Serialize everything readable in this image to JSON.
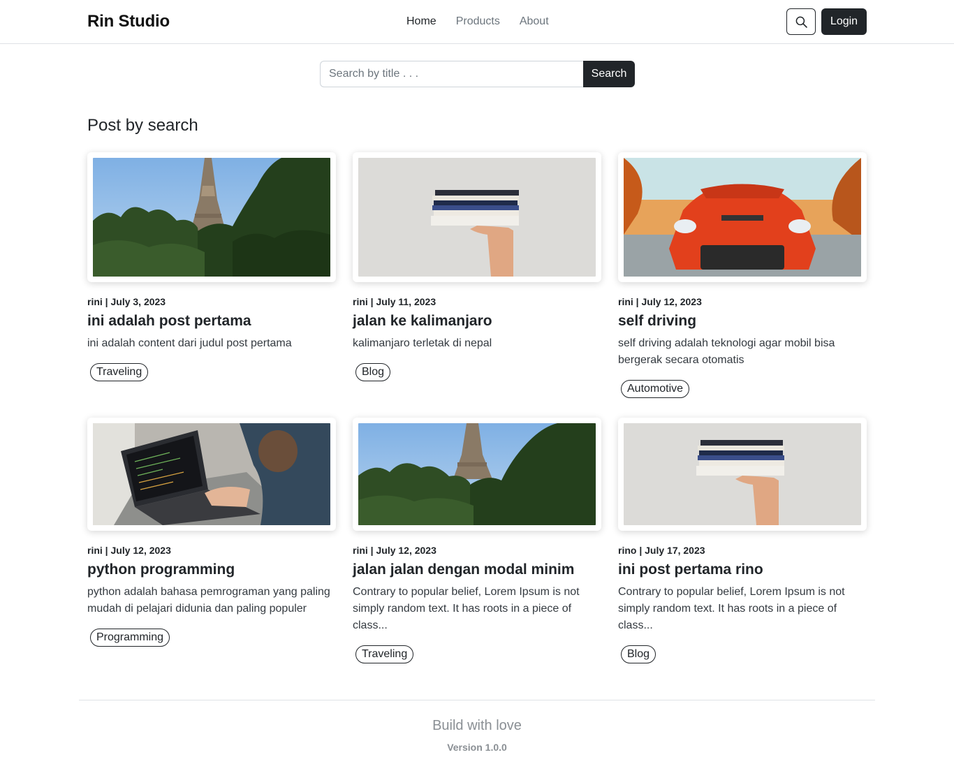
{
  "navbar": {
    "brand": "Rin Studio",
    "links": [
      "Home",
      "Products",
      "About"
    ],
    "search_icon": "search-icon",
    "login_label": "Login"
  },
  "search": {
    "placeholder": "Search by title . . .",
    "button_label": "Search"
  },
  "section_title": "Post by search",
  "posts": [
    {
      "meta": "rini | July 3, 2023",
      "title": "ini adalah post pertama",
      "excerpt": "ini adalah content dari judul post pertama",
      "tag": "Traveling",
      "image": "eiffel-tower-trees"
    },
    {
      "meta": "rini | July 11, 2023",
      "title": "jalan ke kalimanjaro",
      "excerpt": "kalimanjaro terletak di nepal",
      "tag": "Blog",
      "image": "hand-holding-books"
    },
    {
      "meta": "rini | July 12, 2023",
      "title": "self driving",
      "excerpt": "self driving adalah teknologi agar mobil bisa bergerak secara otomatis",
      "tag": "Automotive",
      "image": "red-sports-car"
    },
    {
      "meta": "rini | July 12, 2023",
      "title": "python programming",
      "excerpt": "python adalah bahasa pemrograman yang paling mudah di pelajari didunia dan paling populer",
      "tag": "Programming",
      "image": "man-typing-laptop"
    },
    {
      "meta": "rini | July 12, 2023",
      "title": "jalan jalan dengan modal minim",
      "excerpt": "Contrary to popular belief, Lorem Ipsum is not simply random text. It has roots in a piece of class...",
      "tag": "Traveling",
      "image": "eiffel-tower-trees"
    },
    {
      "meta": "rino | July 17, 2023",
      "title": "ini post pertama rino",
      "excerpt": "Contrary to popular belief, Lorem Ipsum is not simply random text. It has roots in a piece of class...",
      "tag": "Blog",
      "image": "hand-holding-books"
    }
  ],
  "footer": {
    "tagline": "Build with love",
    "version": "Version 1.0.0"
  },
  "colors": {
    "primary_dark": "#212529",
    "muted": "#6c757d",
    "border": "#dee2e6"
  }
}
